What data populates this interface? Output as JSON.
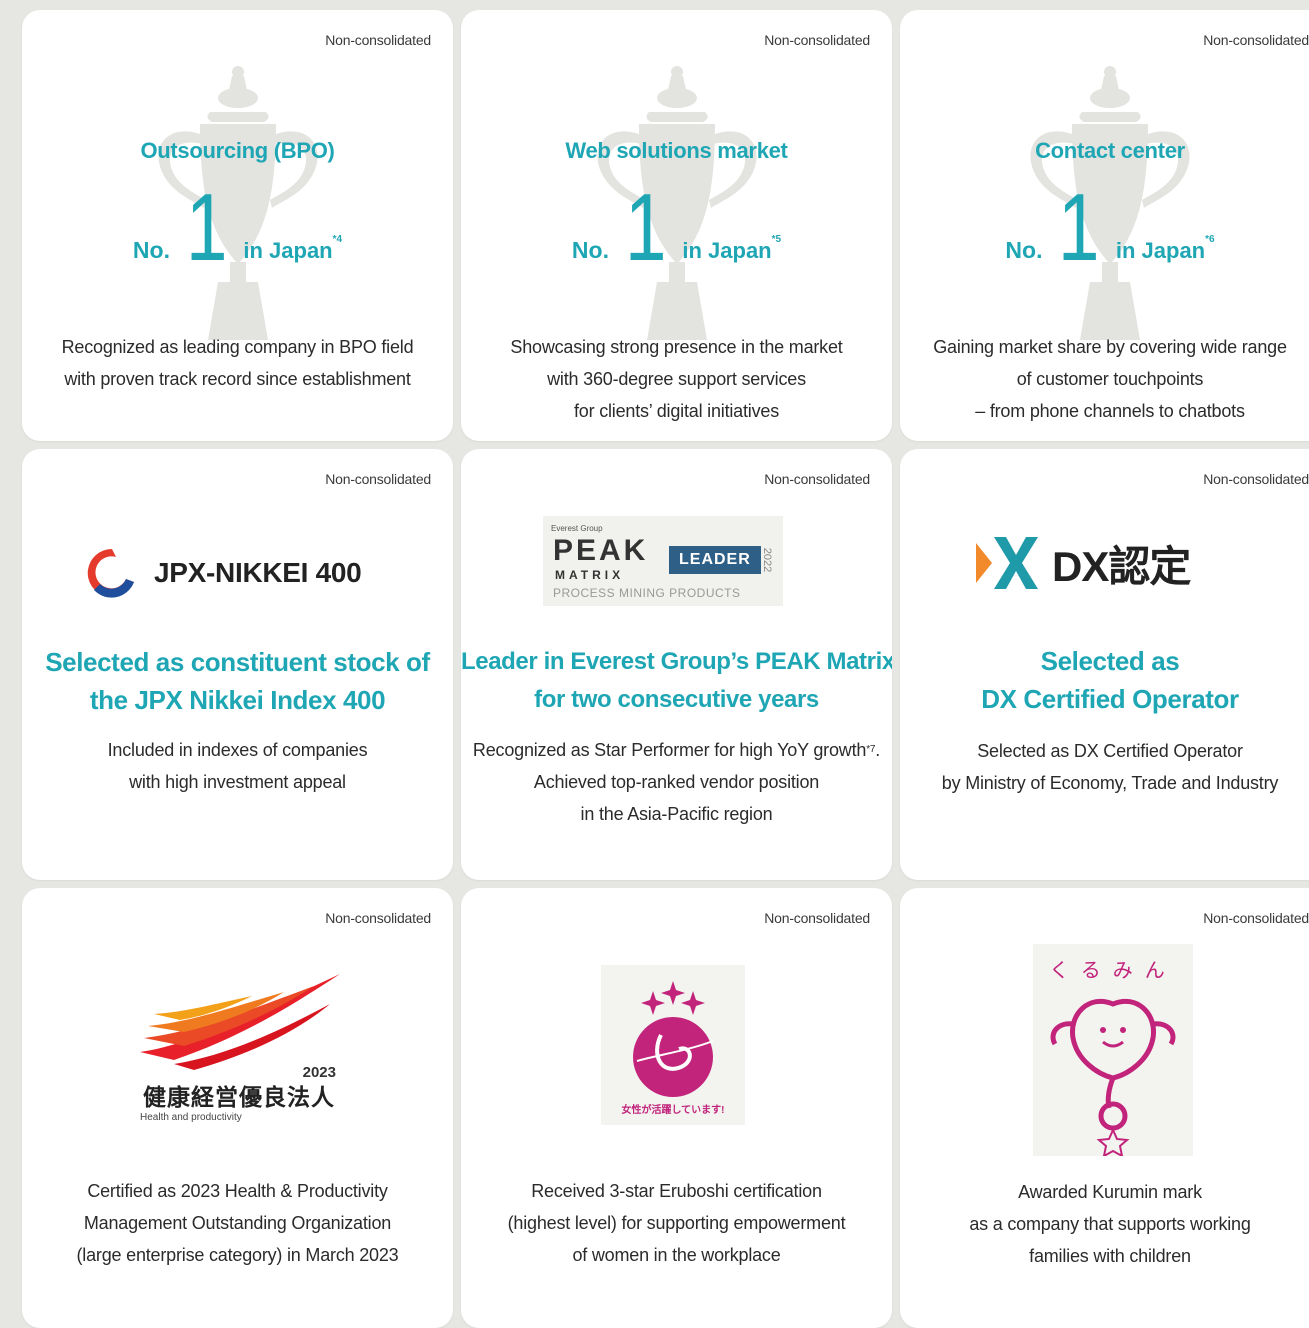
{
  "colors": {
    "accent": "#1fa6b4",
    "card_bg": "#ffffff",
    "page_bg": "#e6e6e3"
  },
  "cards": [
    {
      "tag": "Non-consolidated",
      "category": "Outsourcing (BPO)",
      "rank_no": "No.",
      "rank_num": "1",
      "rank_suffix": "in Japan",
      "rank_note": "*4",
      "desc": [
        "Recognized as leading company in BPO field",
        "with proven track record since establishment"
      ]
    },
    {
      "tag": "Non-consolidated",
      "category": "Web solutions market",
      "rank_no": "No.",
      "rank_num": "1",
      "rank_suffix": "in Japan",
      "rank_note": "*5",
      "desc": [
        "Showcasing strong presence in the market",
        "with 360-degree support services",
        "for clients’ digital initiatives"
      ]
    },
    {
      "tag": "Non-consolidated",
      "category": "Contact center",
      "rank_no": "No.",
      "rank_num": "1",
      "rank_suffix": "in Japan",
      "rank_note": "*6",
      "desc": [
        "Gaining market share by covering wide range",
        "of customer touchpoints",
        "– from phone channels to chatbots"
      ]
    },
    {
      "tag": "Non-consolidated",
      "logo_text": "JPX-NIKKEI 400",
      "title": [
        "Selected as constituent stock of",
        "the JPX Nikkei Index 400"
      ],
      "desc": [
        "Included in indexes of companies",
        "with high investment appeal"
      ]
    },
    {
      "tag": "Non-consolidated",
      "logo": {
        "group": "Everest Group",
        "peak": "PEAK",
        "matrix": "MATRIX",
        "leader": "LEADER",
        "year": "2022",
        "sub": "PROCESS MINING PRODUCTS"
      },
      "title": [
        "Leader in Everest Group’s PEAK Matrix",
        "for two consecutive years"
      ],
      "title_mark": "®",
      "desc": [
        "Recognized as Star Performer for high YoY growth",
        "Achieved top-ranked vendor position",
        "in the Asia-Pacific region"
      ],
      "desc_note": "*7",
      "desc_end": "."
    },
    {
      "tag": "Non-consolidated",
      "logo_text": "DX認定",
      "title": [
        "Selected as",
        "DX Certified Operator"
      ],
      "desc": [
        "Selected as DX Certified Operator",
        "by Ministry of Economy, Trade and Industry"
      ]
    },
    {
      "tag": "Non-consolidated",
      "logo": {
        "year": "2023",
        "jp": "健康経営優良法人",
        "en": "Health and productivity"
      },
      "desc": [
        "Certified as 2023 Health & Productivity",
        "Management Outstanding Organization",
        "(large enterprise category) in March 2023"
      ]
    },
    {
      "tag": "Non-consolidated",
      "logo": {
        "arc_text": "女性が活躍しています!"
      },
      "desc": [
        "Received 3-star Eruboshi certification",
        "(highest level) for supporting empowerment",
        "of women in the workplace"
      ]
    },
    {
      "tag": "Non-consolidated",
      "logo": {
        "arc_text": "くるみん"
      },
      "desc": [
        "Awarded Kurumin mark",
        "as a company that supports working",
        "families with children"
      ]
    }
  ]
}
